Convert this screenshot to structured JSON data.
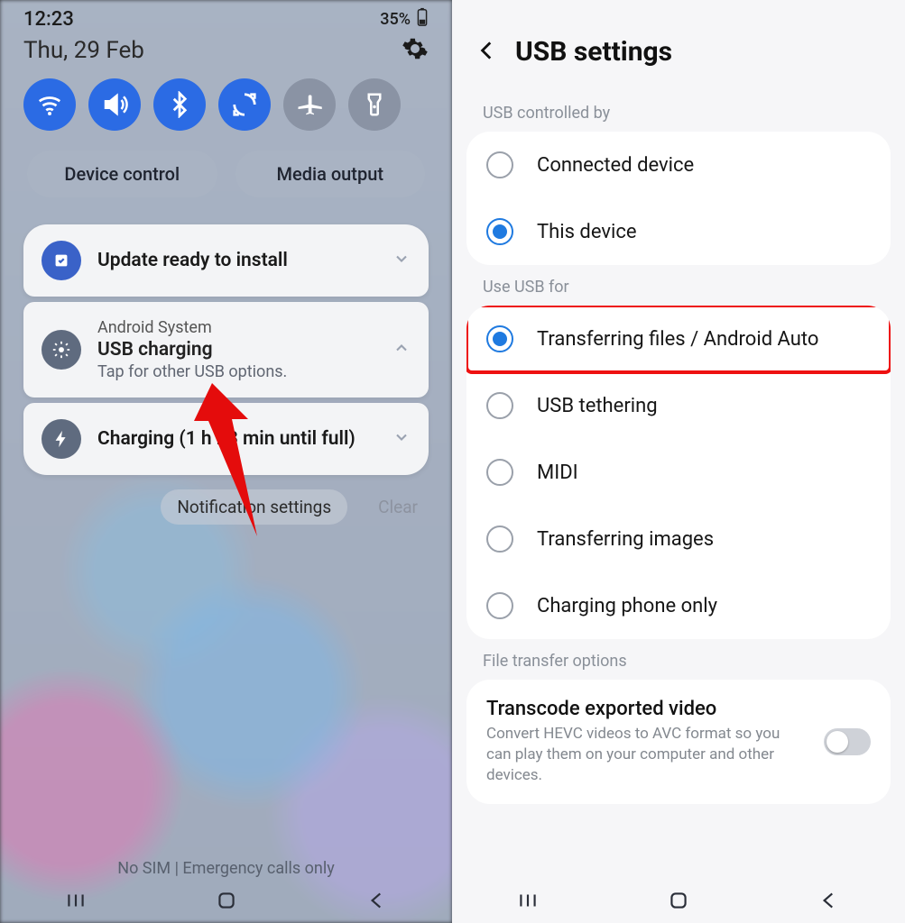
{
  "left": {
    "time": "12:23",
    "battery": "35%",
    "date": "Thu, 29 Feb",
    "device_control": "Device control",
    "media_output": "Media output",
    "cards": {
      "update": {
        "title": "Update ready to install"
      },
      "usb": {
        "source": "Android System",
        "title": "USB charging",
        "subtitle": "Tap for other USB options."
      },
      "charging": {
        "title": "Charging (1 h 23 min until full)"
      }
    },
    "notif_settings": "Notification settings",
    "clear": "Clear",
    "sim_line": "No SIM | Emergency calls only"
  },
  "right": {
    "title": "USB settings",
    "sect1": "USB controlled by",
    "opt_connected": "Connected device",
    "opt_this": "This device",
    "sect2": "Use USB for",
    "opt_transfer": "Transferring files / Android Auto",
    "opt_tether": "USB tethering",
    "opt_midi": "MIDI",
    "opt_images": "Transferring images",
    "opt_charge": "Charging phone only",
    "sect3": "File transfer options",
    "transcode_title": "Transcode exported video",
    "transcode_desc": "Convert HEVC videos to AVC format so you can play them on your computer and other devices."
  }
}
